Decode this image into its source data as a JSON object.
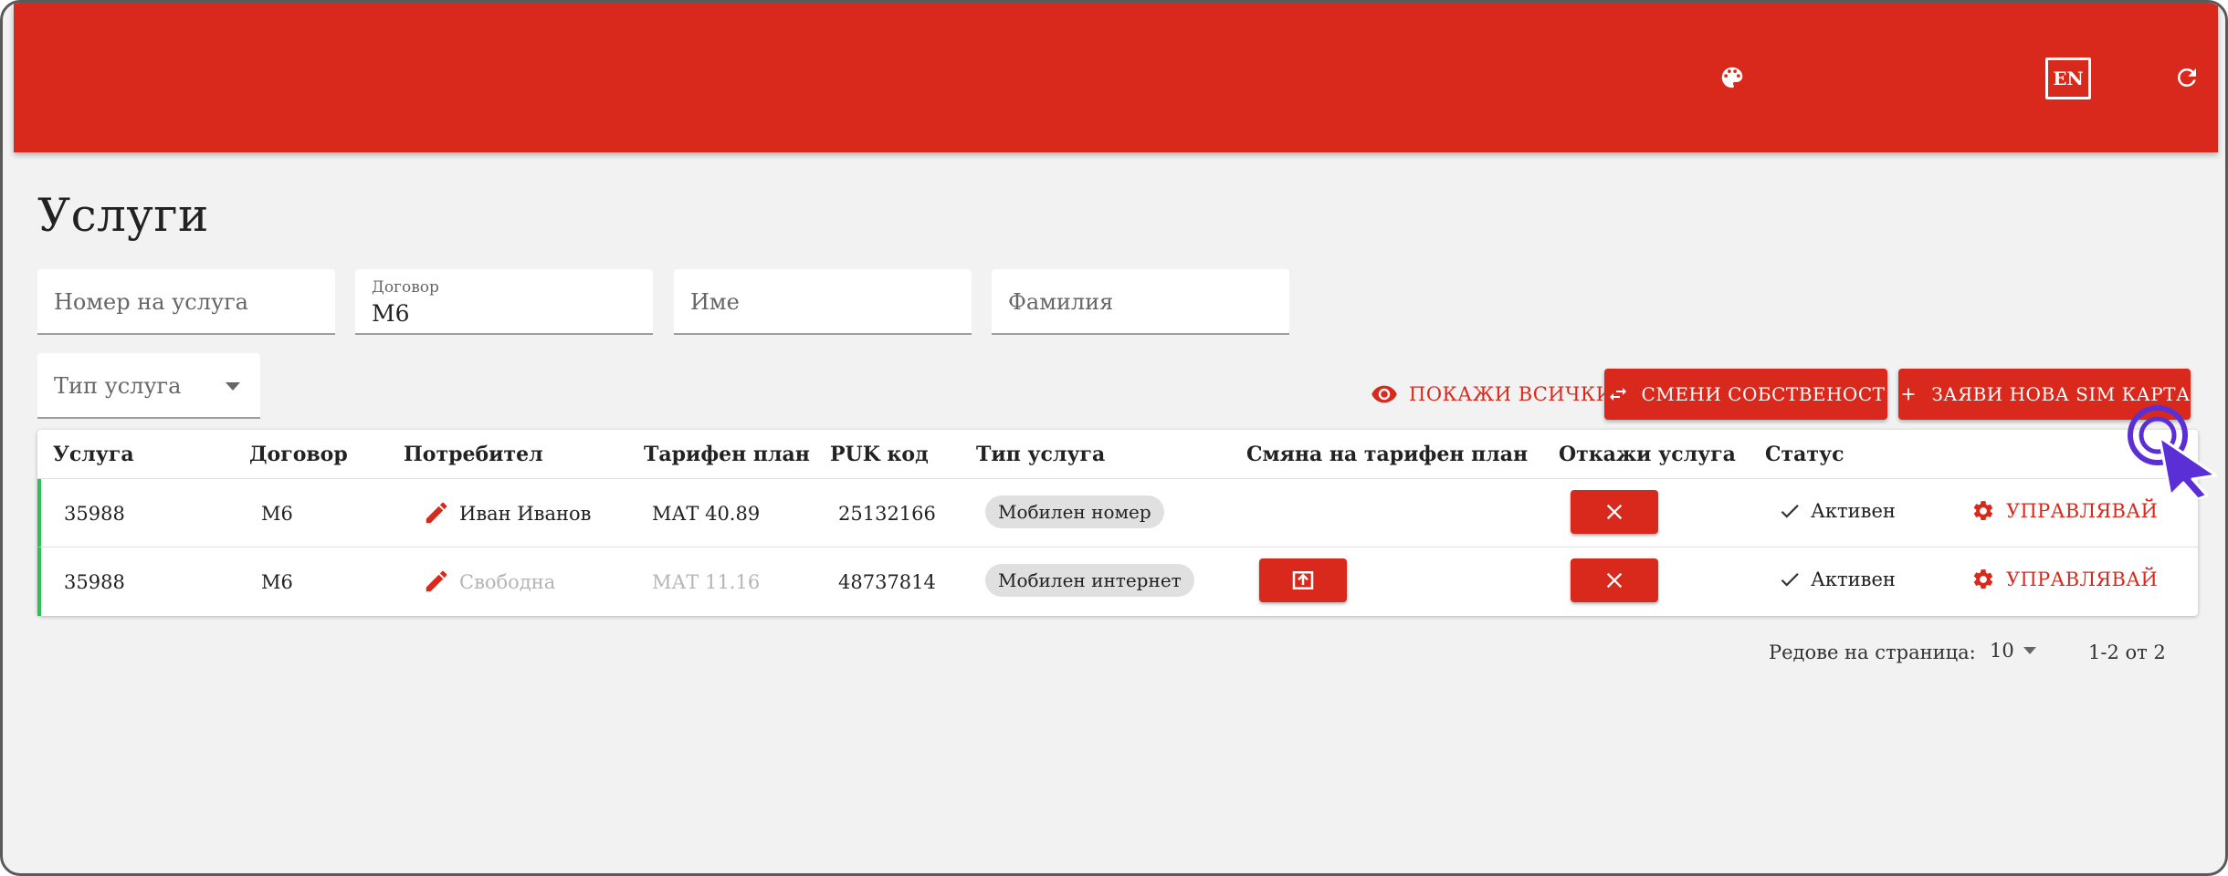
{
  "appbar": {
    "brand_color": "#d8291c",
    "icons": [
      "palette-icon",
      "refresh-icon"
    ],
    "lang_label": "EN"
  },
  "page": {
    "title": "Услуги"
  },
  "filters": {
    "service_number": {
      "placeholder": "Номер на услуга",
      "value": ""
    },
    "contract": {
      "label": "Договор",
      "value": "М6"
    },
    "first_name": {
      "placeholder": "Име",
      "value": ""
    },
    "last_name": {
      "placeholder": "Фамилия",
      "value": ""
    },
    "service_type": {
      "placeholder": "Тип услуга",
      "value": ""
    }
  },
  "actions": {
    "show_all": "ПОКАЖИ ВСИЧКИ",
    "change_owner": "СМЕНИ СОБСТВЕНОСТ",
    "new_sim": "ЗАЯВИ НОВА SIM КАРТА"
  },
  "table": {
    "columns": [
      "Услуга",
      "Договор",
      "Потребител",
      "Тарифен план",
      "PUK код",
      "Тип услуга",
      "Смяна на тарифен план",
      "Откажи услуга",
      "Статус"
    ],
    "rows": [
      {
        "service": "35988",
        "contract": "М6",
        "user": "Иван Иванов",
        "user_muted": false,
        "plan": "МАТ 40.89",
        "plan_muted": false,
        "puk": "25132166",
        "type": "Мобилен номер",
        "can_change_plan": false,
        "status": "Активен",
        "manage": "УПРАВЛЯВАЙ"
      },
      {
        "service": "35988",
        "contract": "М6",
        "user": "Свободна",
        "user_muted": true,
        "plan": "МАТ 11.16",
        "plan_muted": true,
        "puk": "48737814",
        "type": "Мобилен интернет",
        "can_change_plan": true,
        "status": "Активен",
        "manage": "УПРАВЛЯВАЙ"
      }
    ]
  },
  "pagination": {
    "rows_per_page_label": "Редове на страница:",
    "rows_per_page": "10",
    "range": "1-2 от 2"
  },
  "colors": {
    "accent": "#d8291c",
    "active_row": "#2fbf57",
    "cursor": "#5b2fd6"
  }
}
